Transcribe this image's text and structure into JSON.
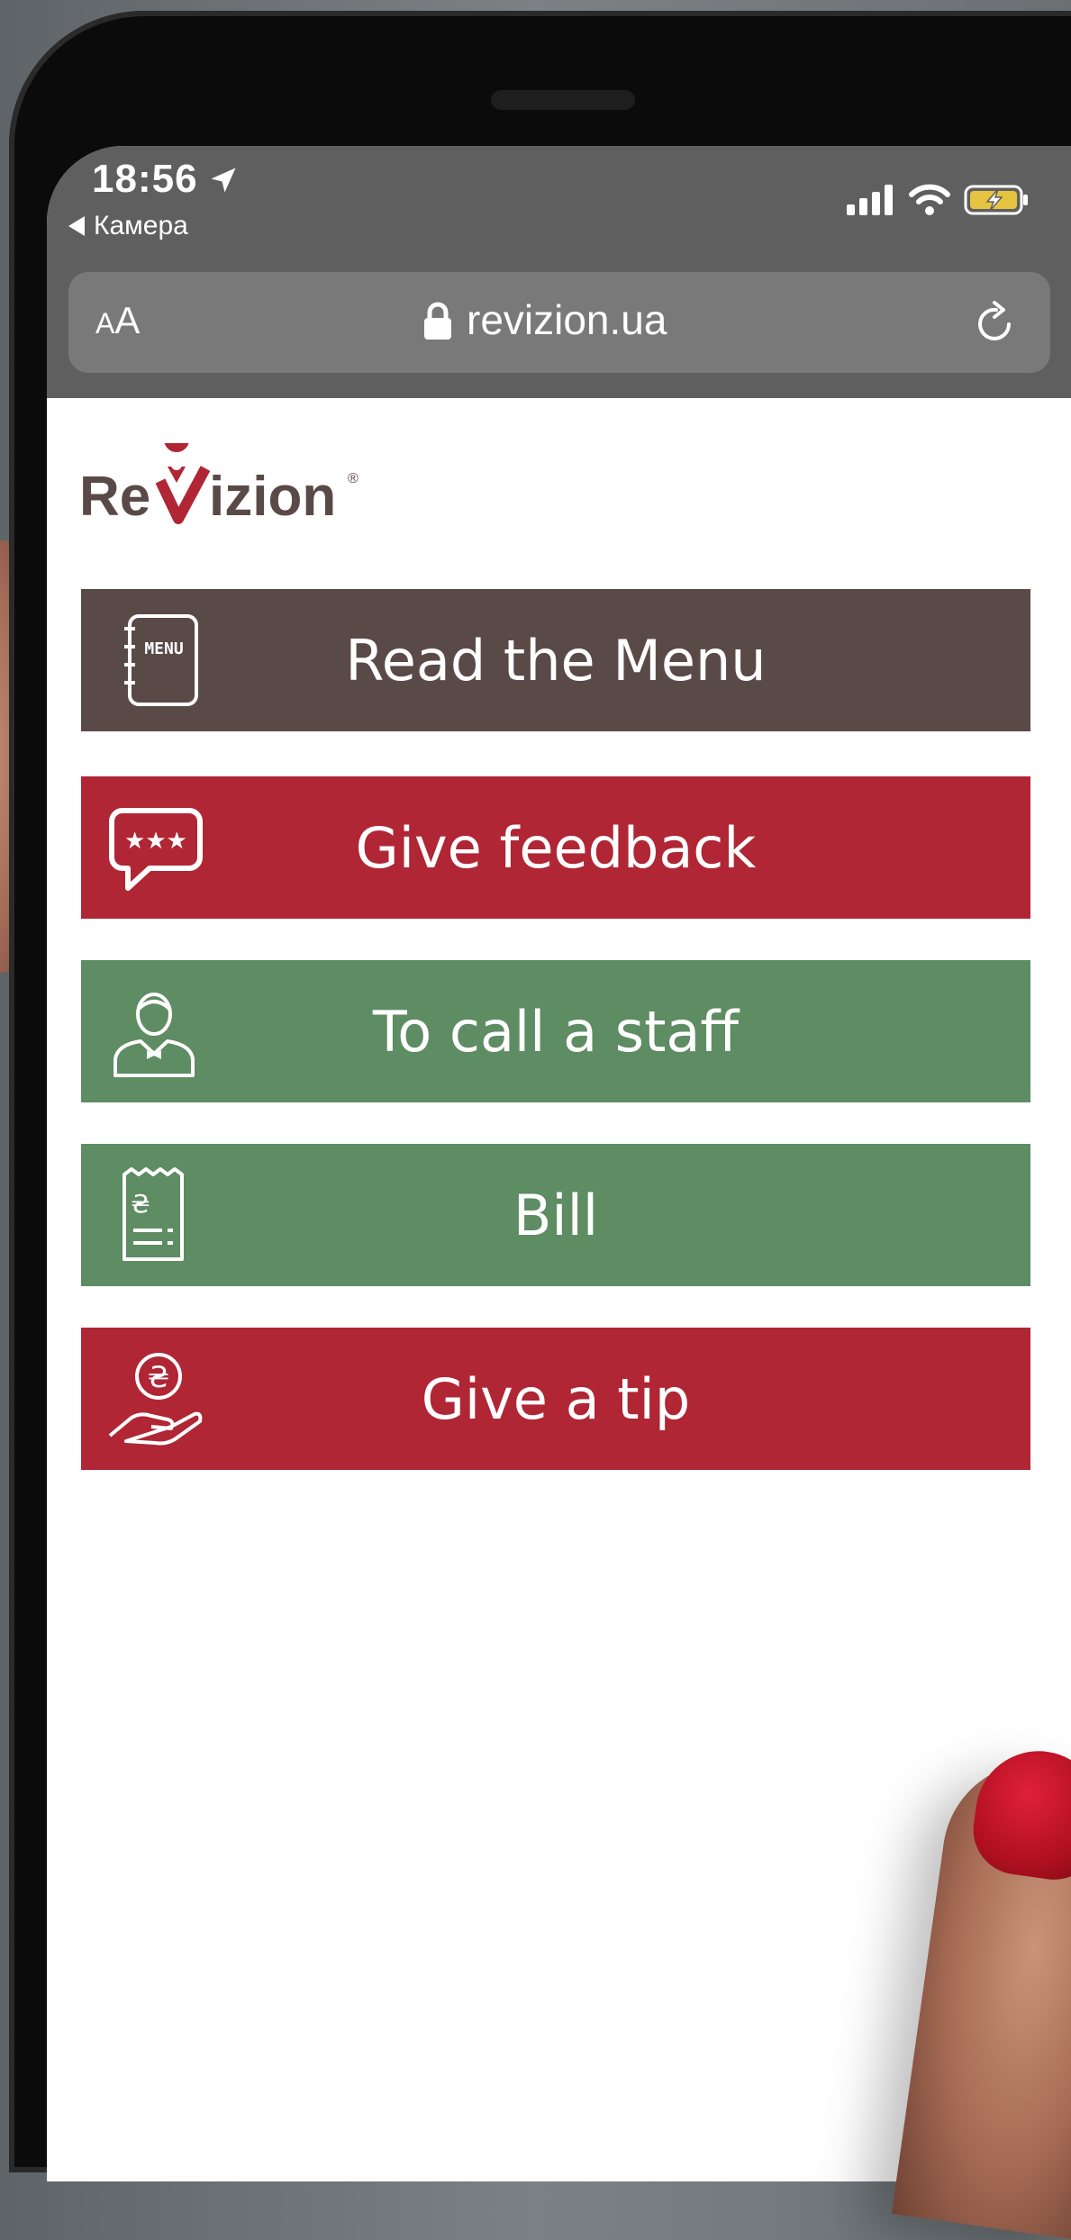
{
  "status_bar": {
    "time": "18:56",
    "back_label": "Камера"
  },
  "browser": {
    "text_size_small": "A",
    "text_size_large": "A",
    "domain": "revizion.ua"
  },
  "brand": {
    "logo_text": "ReVizion",
    "accent": "#b02634"
  },
  "buttons": [
    {
      "label": "Read the Menu",
      "icon": "menu-book-icon",
      "color": "#5a4a47"
    },
    {
      "label": "Give feedback",
      "icon": "speech-bubble-stars-icon",
      "color": "#b02634"
    },
    {
      "label": "To call a staff",
      "icon": "waiter-icon",
      "color": "#5e8c63"
    },
    {
      "label": "Bill",
      "icon": "receipt-icon",
      "color": "#5e8c63"
    },
    {
      "label": "Give a tip",
      "icon": "hand-coin-icon",
      "color": "#b02634"
    }
  ]
}
